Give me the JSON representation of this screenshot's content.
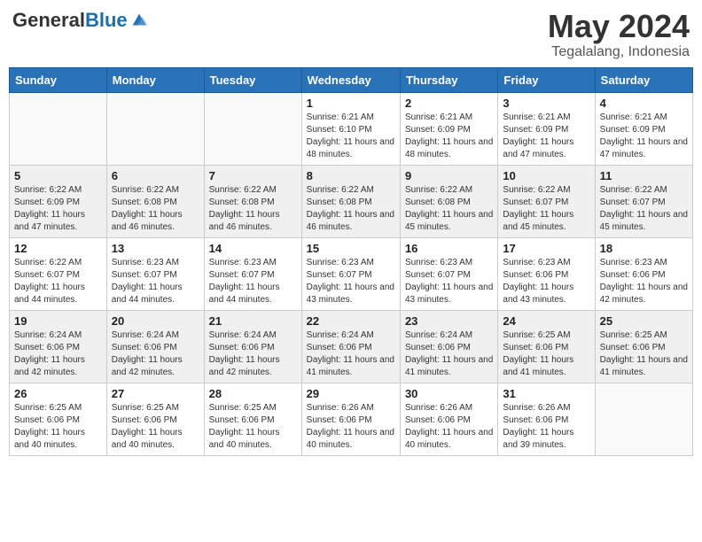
{
  "header": {
    "logo_general": "General",
    "logo_blue": "Blue",
    "month_title": "May 2024",
    "location": "Tegalalang, Indonesia"
  },
  "weekdays": [
    "Sunday",
    "Monday",
    "Tuesday",
    "Wednesday",
    "Thursday",
    "Friday",
    "Saturday"
  ],
  "weeks": [
    [
      {
        "day": "",
        "sunrise": "",
        "sunset": "",
        "daylight": ""
      },
      {
        "day": "",
        "sunrise": "",
        "sunset": "",
        "daylight": ""
      },
      {
        "day": "",
        "sunrise": "",
        "sunset": "",
        "daylight": ""
      },
      {
        "day": "1",
        "sunrise": "Sunrise: 6:21 AM",
        "sunset": "Sunset: 6:10 PM",
        "daylight": "Daylight: 11 hours and 48 minutes."
      },
      {
        "day": "2",
        "sunrise": "Sunrise: 6:21 AM",
        "sunset": "Sunset: 6:09 PM",
        "daylight": "Daylight: 11 hours and 48 minutes."
      },
      {
        "day": "3",
        "sunrise": "Sunrise: 6:21 AM",
        "sunset": "Sunset: 6:09 PM",
        "daylight": "Daylight: 11 hours and 47 minutes."
      },
      {
        "day": "4",
        "sunrise": "Sunrise: 6:21 AM",
        "sunset": "Sunset: 6:09 PM",
        "daylight": "Daylight: 11 hours and 47 minutes."
      }
    ],
    [
      {
        "day": "5",
        "sunrise": "Sunrise: 6:22 AM",
        "sunset": "Sunset: 6:09 PM",
        "daylight": "Daylight: 11 hours and 47 minutes."
      },
      {
        "day": "6",
        "sunrise": "Sunrise: 6:22 AM",
        "sunset": "Sunset: 6:08 PM",
        "daylight": "Daylight: 11 hours and 46 minutes."
      },
      {
        "day": "7",
        "sunrise": "Sunrise: 6:22 AM",
        "sunset": "Sunset: 6:08 PM",
        "daylight": "Daylight: 11 hours and 46 minutes."
      },
      {
        "day": "8",
        "sunrise": "Sunrise: 6:22 AM",
        "sunset": "Sunset: 6:08 PM",
        "daylight": "Daylight: 11 hours and 46 minutes."
      },
      {
        "day": "9",
        "sunrise": "Sunrise: 6:22 AM",
        "sunset": "Sunset: 6:08 PM",
        "daylight": "Daylight: 11 hours and 45 minutes."
      },
      {
        "day": "10",
        "sunrise": "Sunrise: 6:22 AM",
        "sunset": "Sunset: 6:07 PM",
        "daylight": "Daylight: 11 hours and 45 minutes."
      },
      {
        "day": "11",
        "sunrise": "Sunrise: 6:22 AM",
        "sunset": "Sunset: 6:07 PM",
        "daylight": "Daylight: 11 hours and 45 minutes."
      }
    ],
    [
      {
        "day": "12",
        "sunrise": "Sunrise: 6:22 AM",
        "sunset": "Sunset: 6:07 PM",
        "daylight": "Daylight: 11 hours and 44 minutes."
      },
      {
        "day": "13",
        "sunrise": "Sunrise: 6:23 AM",
        "sunset": "Sunset: 6:07 PM",
        "daylight": "Daylight: 11 hours and 44 minutes."
      },
      {
        "day": "14",
        "sunrise": "Sunrise: 6:23 AM",
        "sunset": "Sunset: 6:07 PM",
        "daylight": "Daylight: 11 hours and 44 minutes."
      },
      {
        "day": "15",
        "sunrise": "Sunrise: 6:23 AM",
        "sunset": "Sunset: 6:07 PM",
        "daylight": "Daylight: 11 hours and 43 minutes."
      },
      {
        "day": "16",
        "sunrise": "Sunrise: 6:23 AM",
        "sunset": "Sunset: 6:07 PM",
        "daylight": "Daylight: 11 hours and 43 minutes."
      },
      {
        "day": "17",
        "sunrise": "Sunrise: 6:23 AM",
        "sunset": "Sunset: 6:06 PM",
        "daylight": "Daylight: 11 hours and 43 minutes."
      },
      {
        "day": "18",
        "sunrise": "Sunrise: 6:23 AM",
        "sunset": "Sunset: 6:06 PM",
        "daylight": "Daylight: 11 hours and 42 minutes."
      }
    ],
    [
      {
        "day": "19",
        "sunrise": "Sunrise: 6:24 AM",
        "sunset": "Sunset: 6:06 PM",
        "daylight": "Daylight: 11 hours and 42 minutes."
      },
      {
        "day": "20",
        "sunrise": "Sunrise: 6:24 AM",
        "sunset": "Sunset: 6:06 PM",
        "daylight": "Daylight: 11 hours and 42 minutes."
      },
      {
        "day": "21",
        "sunrise": "Sunrise: 6:24 AM",
        "sunset": "Sunset: 6:06 PM",
        "daylight": "Daylight: 11 hours and 42 minutes."
      },
      {
        "day": "22",
        "sunrise": "Sunrise: 6:24 AM",
        "sunset": "Sunset: 6:06 PM",
        "daylight": "Daylight: 11 hours and 41 minutes."
      },
      {
        "day": "23",
        "sunrise": "Sunrise: 6:24 AM",
        "sunset": "Sunset: 6:06 PM",
        "daylight": "Daylight: 11 hours and 41 minutes."
      },
      {
        "day": "24",
        "sunrise": "Sunrise: 6:25 AM",
        "sunset": "Sunset: 6:06 PM",
        "daylight": "Daylight: 11 hours and 41 minutes."
      },
      {
        "day": "25",
        "sunrise": "Sunrise: 6:25 AM",
        "sunset": "Sunset: 6:06 PM",
        "daylight": "Daylight: 11 hours and 41 minutes."
      }
    ],
    [
      {
        "day": "26",
        "sunrise": "Sunrise: 6:25 AM",
        "sunset": "Sunset: 6:06 PM",
        "daylight": "Daylight: 11 hours and 40 minutes."
      },
      {
        "day": "27",
        "sunrise": "Sunrise: 6:25 AM",
        "sunset": "Sunset: 6:06 PM",
        "daylight": "Daylight: 11 hours and 40 minutes."
      },
      {
        "day": "28",
        "sunrise": "Sunrise: 6:25 AM",
        "sunset": "Sunset: 6:06 PM",
        "daylight": "Daylight: 11 hours and 40 minutes."
      },
      {
        "day": "29",
        "sunrise": "Sunrise: 6:26 AM",
        "sunset": "Sunset: 6:06 PM",
        "daylight": "Daylight: 11 hours and 40 minutes."
      },
      {
        "day": "30",
        "sunrise": "Sunrise: 6:26 AM",
        "sunset": "Sunset: 6:06 PM",
        "daylight": "Daylight: 11 hours and 40 minutes."
      },
      {
        "day": "31",
        "sunrise": "Sunrise: 6:26 AM",
        "sunset": "Sunset: 6:06 PM",
        "daylight": "Daylight: 11 hours and 39 minutes."
      },
      {
        "day": "",
        "sunrise": "",
        "sunset": "",
        "daylight": ""
      }
    ]
  ]
}
